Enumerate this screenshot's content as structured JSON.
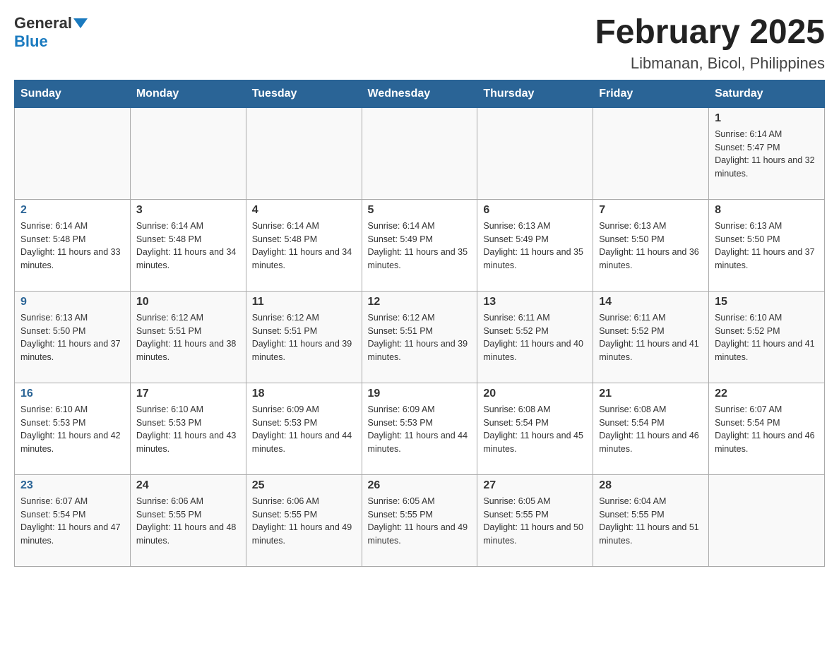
{
  "header": {
    "logo_general": "General",
    "logo_blue": "Blue",
    "month_title": "February 2025",
    "location": "Libmanan, Bicol, Philippines"
  },
  "days_of_week": [
    "Sunday",
    "Monday",
    "Tuesday",
    "Wednesday",
    "Thursday",
    "Friday",
    "Saturday"
  ],
  "weeks": [
    {
      "cells": [
        {
          "day": "",
          "info": ""
        },
        {
          "day": "",
          "info": ""
        },
        {
          "day": "",
          "info": ""
        },
        {
          "day": "",
          "info": ""
        },
        {
          "day": "",
          "info": ""
        },
        {
          "day": "",
          "info": ""
        },
        {
          "day": "1",
          "info": "Sunrise: 6:14 AM\nSunset: 5:47 PM\nDaylight: 11 hours and 32 minutes."
        }
      ]
    },
    {
      "cells": [
        {
          "day": "2",
          "info": "Sunrise: 6:14 AM\nSunset: 5:48 PM\nDaylight: 11 hours and 33 minutes."
        },
        {
          "day": "3",
          "info": "Sunrise: 6:14 AM\nSunset: 5:48 PM\nDaylight: 11 hours and 34 minutes."
        },
        {
          "day": "4",
          "info": "Sunrise: 6:14 AM\nSunset: 5:48 PM\nDaylight: 11 hours and 34 minutes."
        },
        {
          "day": "5",
          "info": "Sunrise: 6:14 AM\nSunset: 5:49 PM\nDaylight: 11 hours and 35 minutes."
        },
        {
          "day": "6",
          "info": "Sunrise: 6:13 AM\nSunset: 5:49 PM\nDaylight: 11 hours and 35 minutes."
        },
        {
          "day": "7",
          "info": "Sunrise: 6:13 AM\nSunset: 5:50 PM\nDaylight: 11 hours and 36 minutes."
        },
        {
          "day": "8",
          "info": "Sunrise: 6:13 AM\nSunset: 5:50 PM\nDaylight: 11 hours and 37 minutes."
        }
      ]
    },
    {
      "cells": [
        {
          "day": "9",
          "info": "Sunrise: 6:13 AM\nSunset: 5:50 PM\nDaylight: 11 hours and 37 minutes."
        },
        {
          "day": "10",
          "info": "Sunrise: 6:12 AM\nSunset: 5:51 PM\nDaylight: 11 hours and 38 minutes."
        },
        {
          "day": "11",
          "info": "Sunrise: 6:12 AM\nSunset: 5:51 PM\nDaylight: 11 hours and 39 minutes."
        },
        {
          "day": "12",
          "info": "Sunrise: 6:12 AM\nSunset: 5:51 PM\nDaylight: 11 hours and 39 minutes."
        },
        {
          "day": "13",
          "info": "Sunrise: 6:11 AM\nSunset: 5:52 PM\nDaylight: 11 hours and 40 minutes."
        },
        {
          "day": "14",
          "info": "Sunrise: 6:11 AM\nSunset: 5:52 PM\nDaylight: 11 hours and 41 minutes."
        },
        {
          "day": "15",
          "info": "Sunrise: 6:10 AM\nSunset: 5:52 PM\nDaylight: 11 hours and 41 minutes."
        }
      ]
    },
    {
      "cells": [
        {
          "day": "16",
          "info": "Sunrise: 6:10 AM\nSunset: 5:53 PM\nDaylight: 11 hours and 42 minutes."
        },
        {
          "day": "17",
          "info": "Sunrise: 6:10 AM\nSunset: 5:53 PM\nDaylight: 11 hours and 43 minutes."
        },
        {
          "day": "18",
          "info": "Sunrise: 6:09 AM\nSunset: 5:53 PM\nDaylight: 11 hours and 44 minutes."
        },
        {
          "day": "19",
          "info": "Sunrise: 6:09 AM\nSunset: 5:53 PM\nDaylight: 11 hours and 44 minutes."
        },
        {
          "day": "20",
          "info": "Sunrise: 6:08 AM\nSunset: 5:54 PM\nDaylight: 11 hours and 45 minutes."
        },
        {
          "day": "21",
          "info": "Sunrise: 6:08 AM\nSunset: 5:54 PM\nDaylight: 11 hours and 46 minutes."
        },
        {
          "day": "22",
          "info": "Sunrise: 6:07 AM\nSunset: 5:54 PM\nDaylight: 11 hours and 46 minutes."
        }
      ]
    },
    {
      "cells": [
        {
          "day": "23",
          "info": "Sunrise: 6:07 AM\nSunset: 5:54 PM\nDaylight: 11 hours and 47 minutes."
        },
        {
          "day": "24",
          "info": "Sunrise: 6:06 AM\nSunset: 5:55 PM\nDaylight: 11 hours and 48 minutes."
        },
        {
          "day": "25",
          "info": "Sunrise: 6:06 AM\nSunset: 5:55 PM\nDaylight: 11 hours and 49 minutes."
        },
        {
          "day": "26",
          "info": "Sunrise: 6:05 AM\nSunset: 5:55 PM\nDaylight: 11 hours and 49 minutes."
        },
        {
          "day": "27",
          "info": "Sunrise: 6:05 AM\nSunset: 5:55 PM\nDaylight: 11 hours and 50 minutes."
        },
        {
          "day": "28",
          "info": "Sunrise: 6:04 AM\nSunset: 5:55 PM\nDaylight: 11 hours and 51 minutes."
        },
        {
          "day": "",
          "info": ""
        }
      ]
    }
  ]
}
